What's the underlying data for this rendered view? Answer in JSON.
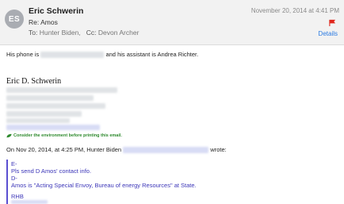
{
  "header": {
    "avatar_initials": "ES",
    "sender_name": "Eric Schwerin",
    "subject": "Re: Amos",
    "date": "November 20, 2014 at 4:41 PM",
    "to_label": "To:",
    "to_value": "Hunter Biden,",
    "cc_label": "Cc:",
    "cc_value": "Devon Archer",
    "details_label": "Details",
    "flag_color": "#e0261c"
  },
  "body": {
    "phone_prefix": "His phone is",
    "phone_suffix": "and his assistant is Andrea Richter.",
    "signature_name": "Eric D. Schwerin",
    "eco_note": "Consider the environment before printing this email.",
    "reply_prefix": "On Nov 20, 2014, at 4:25 PM, Hunter Biden",
    "reply_suffix": "wrote:"
  },
  "quoted": {
    "line1": "E-",
    "line2": "Pls send D Amos' contact info.",
    "line3": "D-",
    "line4": "Amos is \"Acting Special Envoy, Bureau of energy Resources\" at State.",
    "line5": "RHB"
  },
  "colors": {
    "quote_text": "#3b35b8",
    "link_blue": "#2a7ae2",
    "eco_green": "#2e8a2e"
  }
}
